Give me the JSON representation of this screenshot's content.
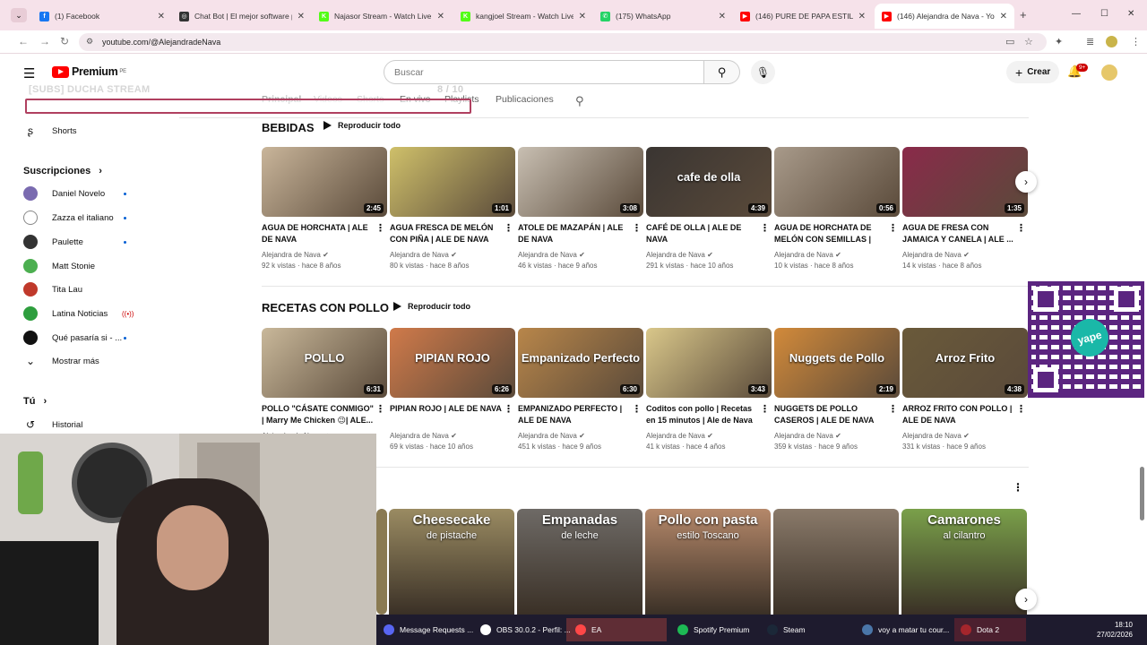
{
  "browser": {
    "tabs": [
      {
        "title": "(1) Facebook",
        "icon": "facebook-icon",
        "color": "#1877f2",
        "letter": "f"
      },
      {
        "title": "Chat Bot | El mejor software pa",
        "icon": "chatbot-icon",
        "color": "#333333",
        "letter": "◎"
      },
      {
        "title": "Najasor Stream - Watch Live o",
        "icon": "kick-icon",
        "color": "#53fc18",
        "letter": "K"
      },
      {
        "title": "kangjoel Stream - Watch Live o",
        "icon": "kick-icon",
        "color": "#53fc18",
        "letter": "K"
      },
      {
        "title": "(175) WhatsApp",
        "icon": "whatsapp-icon",
        "color": "#25d366",
        "letter": "✆"
      },
      {
        "title": "(146) PURE DE PAPA ESTILO",
        "icon": "youtube-icon",
        "color": "#ff0000",
        "letter": "▶"
      },
      {
        "title": "(146) Alejandra de Nava - You",
        "icon": "youtube-icon",
        "color": "#ff0000",
        "letter": "▶"
      }
    ],
    "url": "youtube.com/@AlejandradeNava"
  },
  "masthead": {
    "logo_text": "Premium",
    "region": "PE",
    "search_placeholder": "Buscar",
    "create_label": "Crear",
    "notifications": "9+"
  },
  "overlay": {
    "sub_title": "[SUBS] DUCHA STREAM",
    "sub_count": "8 / 10"
  },
  "sidebar": {
    "shorts": "Shorts",
    "subs_header": "Suscripciones",
    "subs": [
      {
        "name": "Daniel Novelo",
        "color": "#7a6bb0",
        "live": false
      },
      {
        "name": "Zazza el italiano",
        "color": "#ffffff",
        "live": false
      },
      {
        "name": "Paulette",
        "color": "#333333",
        "live": false
      },
      {
        "name": "Matt Stonie",
        "color": "#4caf50",
        "live": false
      },
      {
        "name": "Tita Lau",
        "color": "#c0392b",
        "live": false
      },
      {
        "name": "Latina Noticias",
        "color": "#2e9e3e",
        "live": true
      },
      {
        "name": "Qué pasaría si - ...",
        "color": "#111111",
        "live": false
      }
    ],
    "show_more": "Mostrar más",
    "you_header": "Tú",
    "history": "Historial"
  },
  "channel_tabs": [
    "Principal",
    "Videos",
    "Shorts",
    "En vivo",
    "Playlists",
    "Publicaciones"
  ],
  "shelves": [
    {
      "title": "BEBIDAS",
      "play_all": "Reproducir todo",
      "videos": [
        {
          "title": "AGUA DE HORCHATA | ALE DE NAVA",
          "duration": "2:45",
          "channel": "Alejandra de Nava",
          "views": "92 k vistas",
          "age": "hace 8 años",
          "bg": "#c9b59a",
          "overlay": ""
        },
        {
          "title": "AGUA FRESCA DE MELÓN CON PIÑA | ALE DE NAVA",
          "duration": "1:01",
          "channel": "Alejandra de Nava",
          "views": "80 k vistas",
          "age": "hace 8 años",
          "bg": "#cfc06a",
          "overlay": ""
        },
        {
          "title": "ATOLE DE MAZAPÁN | ALE DE NAVA",
          "duration": "3:08",
          "channel": "Alejandra de Nava",
          "views": "46 k vistas",
          "age": "hace 9 años",
          "bg": "#c8bfb2",
          "overlay": ""
        },
        {
          "title": "CAFÉ DE OLLA | ALE DE NAVA",
          "duration": "4:39",
          "channel": "Alejandra de Nava",
          "views": "291 k vistas",
          "age": "hace 10 años",
          "bg": "#3a3532",
          "overlay": "cafe de olla"
        },
        {
          "title": "AGUA DE HORCHATA DE MELÓN CON SEMILLAS | AL...",
          "duration": "0:56",
          "channel": "Alejandra de Nava",
          "views": "10 k vistas",
          "age": "hace 8 años",
          "bg": "#a89a8a",
          "overlay": ""
        },
        {
          "title": "AGUA DE FRESA CON JAMAICA Y CANELA | ALE ...",
          "duration": "1:35",
          "channel": "Alejandra de Nava",
          "views": "14 k vistas",
          "age": "hace 8 años",
          "bg": "#8a2a4a",
          "overlay": ""
        }
      ]
    },
    {
      "title": "RECETAS CON POLLO",
      "play_all": "Reproducir todo",
      "videos": [
        {
          "title": "POLLO \"CÁSATE CONMIGO\" | Marry Me Chicken 😉| ALE...",
          "duration": "6:31",
          "channel": "Alejandra de Nava",
          "views": "",
          "age": "",
          "bg": "#c9b89a",
          "overlay": "POLLO"
        },
        {
          "title": "PIPIAN ROJO | ALE DE NAVA",
          "duration": "6:26",
          "channel": "Alejandra de Nava",
          "views": "69 k vistas",
          "age": "hace 10 años",
          "bg": "#d07a4a",
          "overlay": "PIPIAN ROJO"
        },
        {
          "title": "EMPANIZADO PERFECTO | ALE DE NAVA",
          "duration": "6:30",
          "channel": "Alejandra de Nava",
          "views": "451 k vistas",
          "age": "hace 9 años",
          "bg": "#b8864a",
          "overlay": "Empanizado Perfecto"
        },
        {
          "title": "Coditos con pollo | Recetas en 15 minutos | Ale de Nava",
          "duration": "3:43",
          "channel": "Alejandra de Nava",
          "views": "41 k vistas",
          "age": "hace 4 años",
          "bg": "#d9c78a",
          "overlay": ""
        },
        {
          "title": "NUGGETS DE POLLO CASEROS | ALE DE NAVA",
          "duration": "2:19",
          "channel": "Alejandra de Nava",
          "views": "359 k vistas",
          "age": "hace 9 años",
          "bg": "#d28a3a",
          "overlay": "Nuggets de Pollo"
        },
        {
          "title": "ARROZ FRITO CON POLLO | ALE DE NAVA",
          "duration": "4:38",
          "channel": "Alejandra de Nava",
          "views": "331 k vistas",
          "age": "hace 9 años",
          "bg": "#6a5a3a",
          "overlay": "Arroz Frito"
        }
      ]
    }
  ],
  "shelf3": [
    {
      "overlay": "Cheesecake",
      "sub": "de pistache",
      "bg": "#9a8b62"
    },
    {
      "overlay": "Empanadas",
      "sub": "de leche",
      "bg": "#6e6a66"
    },
    {
      "overlay": "Pollo con pasta",
      "sub": "estilo Toscano",
      "bg": "#b5886a"
    },
    {
      "overlay": "",
      "sub": "",
      "bg": "#8a7a6a"
    },
    {
      "overlay": "Camarones",
      "sub": "al cilantro",
      "bg": "#7aa04a"
    }
  ],
  "taskbar": {
    "items": [
      {
        "label": "Message Requests ...",
        "color": "#5865f2"
      },
      {
        "label": "OBS 30.0.2 - Perfil: ...",
        "color": "#ffffff"
      },
      {
        "label": "EA",
        "color": "#ff4747"
      },
      {
        "label": "Spotify Premium",
        "color": "#1db954"
      },
      {
        "label": "Steam",
        "color": "#1b2838"
      },
      {
        "label": "voy a matar tu cour...",
        "color": "#4a76a8"
      },
      {
        "label": "Dota 2",
        "color": "#a4262c"
      }
    ],
    "time": "18:10",
    "date": "27/02/2026"
  },
  "qr_label": "yape"
}
